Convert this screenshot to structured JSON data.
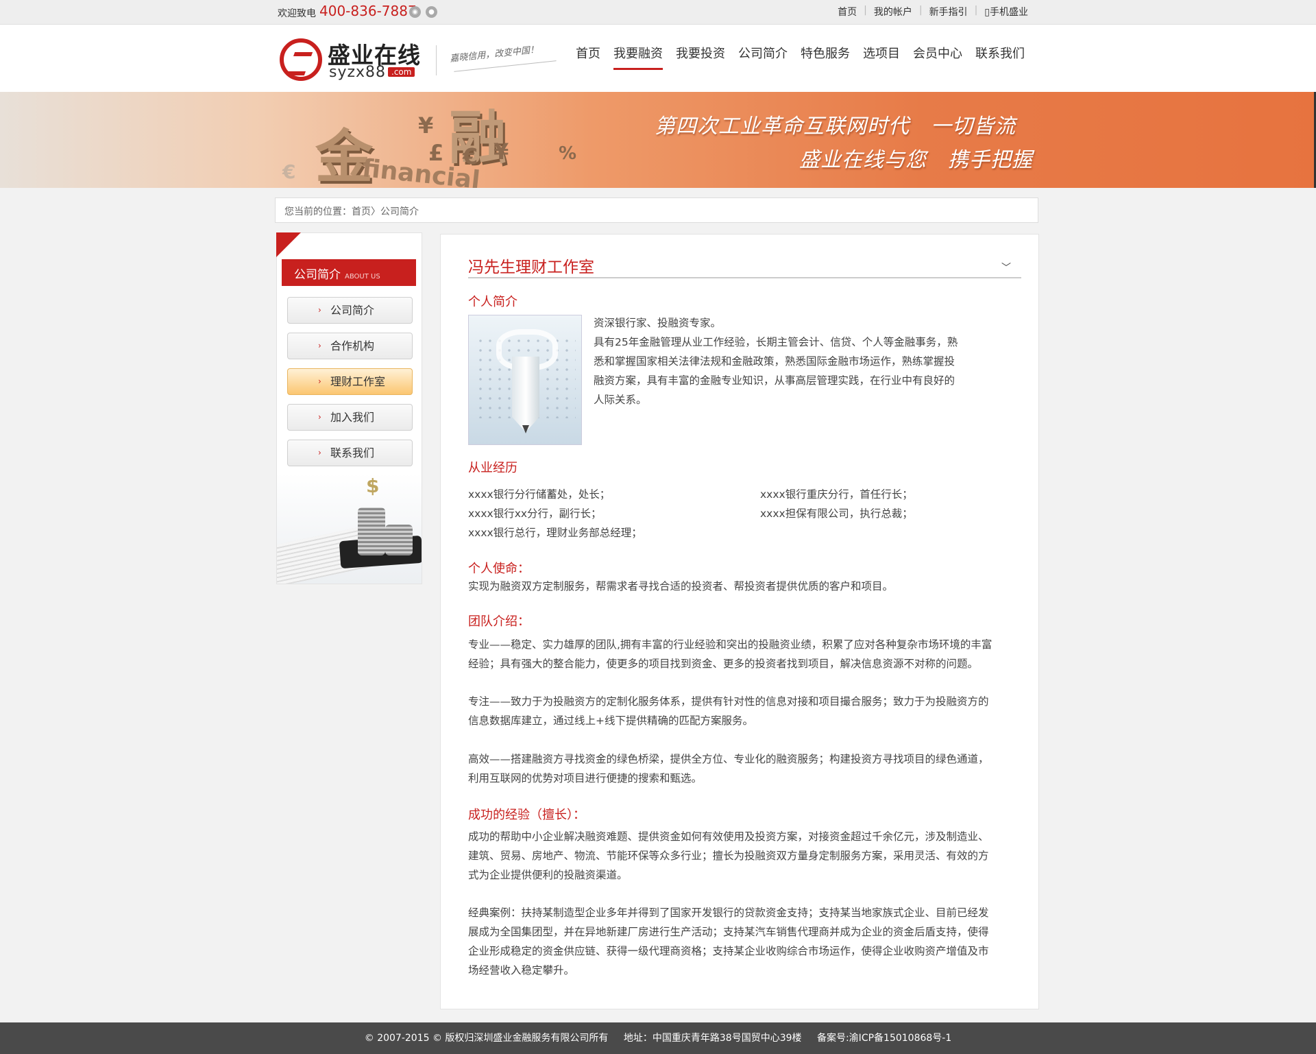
{
  "topbar": {
    "welcome": "欢迎致电",
    "phone": "400-836-7887",
    "links": [
      "首页",
      "我的帐户",
      "新手指引",
      "手机盛业"
    ]
  },
  "header": {
    "logo_cn": "盛业在线",
    "logo_en": "syzx88",
    "logo_com": ".com",
    "slogan": "嘉晓信用，改变中国！",
    "nav": [
      "首页",
      "我要融资",
      "我要投资",
      "公司简介",
      "特色服务",
      "选项目",
      "会员中心",
      "联系我们"
    ],
    "nav_active": "我要融资"
  },
  "banner": {
    "word1": "金",
    "word2": "融",
    "word3": "financial",
    "line1": "第四次工业革命互联网时代　一切皆流",
    "line2": "盛业在线与您　携手把握"
  },
  "breadcrumb": "您当前的位置：首页〉公司简介",
  "sidebar": {
    "title_cn": "公司简介",
    "title_en": "ABOUT US",
    "items": [
      "公司简介",
      "合作机构",
      "理财工作室",
      "加入我们",
      "联系我们"
    ],
    "active": "理财工作室"
  },
  "content": {
    "title": "冯先生理财工作室",
    "intro_heading": "个人简介",
    "intro_lines": [
      "资深银行家、投融资专家。",
      "具有25年金融管理从业工作经验，长期主管会计、信贷、个人等金融事务，熟",
      "悉和掌握国家相关法律法规和金融政策，熟悉国际金融市场运作，熟练掌握投",
      "融资方案，具有丰富的金融专业知识，从事高层管理实践，在行业中有良好的",
      "人际关系。"
    ],
    "exp_heading": "从业经历",
    "exp_left": [
      "xxxx银行分行储蓄处，处长；",
      "xxxx银行xx分行，副行长；",
      "xxxx银行总行，理财业务部总经理；"
    ],
    "exp_right": [
      "xxxx银行重庆分行，首任行长；",
      "xxxx担保有限公司，执行总裁；"
    ],
    "mission_heading": "个人使命：",
    "mission_text": "实现为融资双方定制服务，帮需求者寻找合适的投资者、帮投资者提供优质的客户和项目。",
    "team_heading": "团队介绍：",
    "team_paras": [
      [
        "专业——稳定、实力雄厚的团队,拥有丰富的行业经验和突出的投融资业绩，积累了应对各种复杂市场环境的丰富",
        "经验；具有强大的整合能力，使更多的项目找到资金、更多的投资者找到项目，解决信息资源不对称的问题。"
      ],
      [
        "专注——致力于为投融资方的定制化服务体系，提供有针对性的信息对接和项目撮合服务；致力于为投融资方的",
        "信息数据库建立，通过线上+线下提供精确的匹配方案服务。"
      ],
      [
        "高效——搭建融资方寻找资金的绿色桥梁，提供全方位、专业化的融资服务；构建投资方寻找项目的绿色通道，",
        "利用互联网的优势对项目进行便捷的搜索和甄选。"
      ]
    ],
    "success_heading": "成功的经验（擅长）：",
    "success_paras": [
      [
        "成功的帮助中小企业解决融资难题、提供资金如何有效使用及投资方案，对接资金超过千余亿元，涉及制造业、",
        "建筑、贸易、房地产、物流、节能环保等众多行业；擅长为投融资双方量身定制服务方案，采用灵活、有效的方",
        "式为企业提供便利的投融资渠道。"
      ],
      [
        "经典案例：扶持某制造型企业多年并得到了国家开发银行的贷款资金支持；支持某当地家族式企业、目前已经发",
        "展成为全国集团型，并在异地新建厂房进行生产活动；支持某汽车销售代理商并成为企业的资金后盾支持，使得",
        "企业形成稳定的资金供应链、获得一级代理商资格；支持某企业收购综合市场运作，使得企业收购资产增值及市",
        "场经营收入稳定攀升。"
      ]
    ]
  },
  "footer": {
    "copyright": "© 2007-2015 © 版权归深圳盛业金融服务有限公司所有",
    "address": "地址：中国重庆青年路38号国贸中心39楼",
    "icp": "备案号:渝ICP备15010868号-1"
  }
}
